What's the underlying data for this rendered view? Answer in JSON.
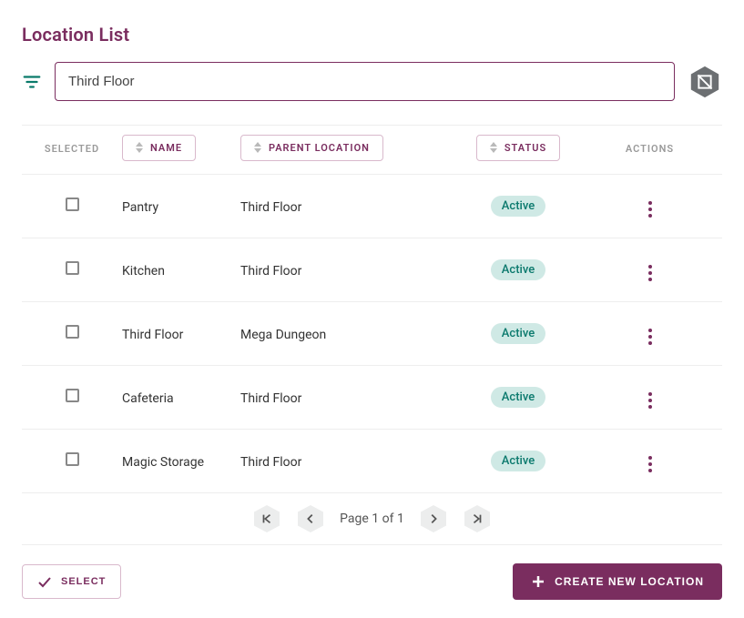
{
  "page": {
    "title": "Location List"
  },
  "search": {
    "value": "Third Floor",
    "placeholder": ""
  },
  "columns": {
    "selected": "Selected",
    "name": "Name",
    "parent": "Parent Location",
    "status": "Status",
    "actions": "Actions"
  },
  "rows": [
    {
      "name": "Pantry",
      "parent": "Third Floor",
      "status": "Active"
    },
    {
      "name": "Kitchen",
      "parent": "Third Floor",
      "status": "Active"
    },
    {
      "name": "Third Floor",
      "parent": "Mega Dungeon",
      "status": "Active"
    },
    {
      "name": "Cafeteria",
      "parent": "Third Floor",
      "status": "Active"
    },
    {
      "name": "Magic Storage",
      "parent": "Third Floor",
      "status": "Active"
    }
  ],
  "pagination": {
    "label": "Page 1 of 1"
  },
  "footer": {
    "select_label": "Select",
    "create_label": "Create New Location"
  }
}
